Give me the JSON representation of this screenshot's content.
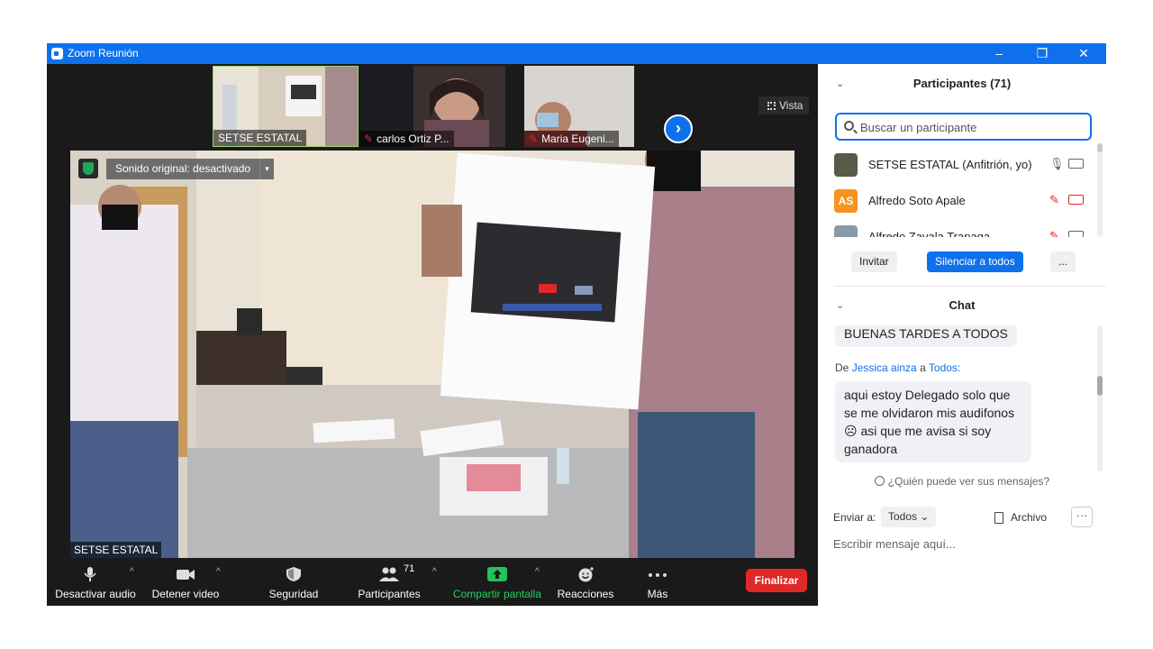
{
  "window": {
    "title": "Zoom Reunión"
  },
  "thumbnails": [
    {
      "name": "SETSE ESTATAL",
      "muted": false
    },
    {
      "name": "carlos Ortiz P...",
      "muted": true
    },
    {
      "name": "Maria Eugeni...",
      "muted": true
    }
  ],
  "view": {
    "label": "Vista"
  },
  "main_video": {
    "audio_notice": "Sonido original: desactivado",
    "name_label": "SETSE ESTATAL"
  },
  "toolbar": {
    "audio": "Desactivar audio",
    "video": "Detener video",
    "security": "Seguridad",
    "participants": "Participantes",
    "participants_count": "71",
    "share": "Compartir pantalla",
    "reactions": "Reacciones",
    "more": "Más",
    "end": "Finalizar"
  },
  "participants_panel": {
    "title": "Participantes (71)",
    "search_placeholder": "Buscar un participante",
    "rows": [
      {
        "name": "SETSE ESTATAL (Anfitrión, yo)",
        "initials": "",
        "avatar_color": "#5a5a4a",
        "muted": false
      },
      {
        "name": "Alfredo Soto Apale",
        "initials": "AS",
        "avatar_color": "#f7931e",
        "muted": true
      },
      {
        "name": "Alfredo Zavala Trapaga",
        "initials": "",
        "avatar_color": "#8a9aa8",
        "muted": true
      }
    ],
    "invite": "Invitar",
    "mute_all": "Silenciar a todos",
    "more": "..."
  },
  "chat": {
    "title": "Chat",
    "messages": [
      {
        "from_prefix": "",
        "from": "",
        "to_prefix": "",
        "to": "",
        "text": "BUENAS TARDES A TODOS"
      },
      {
        "from_prefix": "De",
        "from": "Jessica ainza",
        "to_prefix": "a",
        "to": "Todos:",
        "text": "aqui estoy Delegado solo que se me olvidaron mis audifonos ☹ asi que me avisa si soy ganadora"
      }
    ],
    "who_can_see": "¿Quién puede ver sus mensajes?",
    "send_to_label": "Enviar a:",
    "send_to_value": "Todos",
    "file_label": "Archivo",
    "more": "···",
    "input_placeholder": "Escribir mensaje aquí..."
  }
}
